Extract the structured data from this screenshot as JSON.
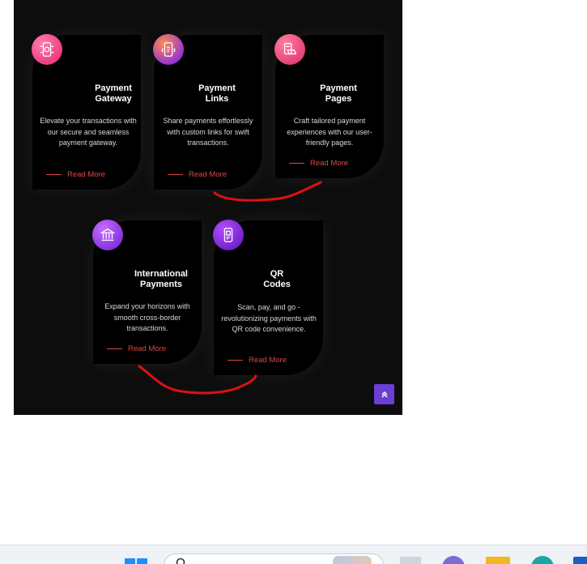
{
  "cards": [
    {
      "title_line1": "Payment",
      "title_line2": "Gateway",
      "description": "Elevate your transactions with our secure and seamless payment gateway.",
      "read_more": "Read More",
      "icon": "payment-gateway-icon"
    },
    {
      "title_line1": "Payment",
      "title_line2": "Links",
      "description": "Share payments effortlessly with custom links for swift transactions.",
      "read_more": "Read More",
      "icon": "payment-links-icon"
    },
    {
      "title_line1": "Payment",
      "title_line2": "Pages",
      "description": "Craft tailored payment experiences with our user-friendly pages.",
      "read_more": "Read More",
      "icon": "payment-pages-icon"
    },
    {
      "title_line1": "International",
      "title_line2": "Payments",
      "description": "Expand your horizons with smooth cross-border transactions.",
      "read_more": "Read More",
      "icon": "bank-icon"
    },
    {
      "title_line1": "QR",
      "title_line2": "Codes",
      "description": "Scan, pay, and go - revolutionizing payments with QR code convenience.",
      "read_more": "Read More",
      "icon": "qr-phone-icon"
    }
  ],
  "colors": {
    "panel_bg": "#0d0d0e",
    "card_bg": "#000000",
    "accent_red": "#d94848",
    "scroll_button": "#6a3fd6",
    "annotation_red": "#e01010"
  },
  "scroll_top_icon": "double-chevron-up-icon",
  "taskbar_icons": [
    "windows-start-icon",
    "search-icon",
    "file-explorer-icon",
    "edge-browser-icon"
  ]
}
